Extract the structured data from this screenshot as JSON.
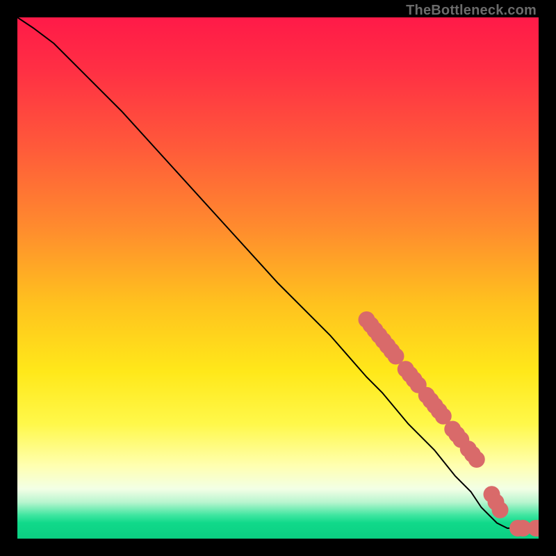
{
  "watermark": "TheBottleneck.com",
  "colors": {
    "background": "#000000",
    "marker": "#d96a6a",
    "line": "#000000",
    "gradient_stops": [
      {
        "offset": 0.0,
        "color": "#ff1a48"
      },
      {
        "offset": 0.1,
        "color": "#ff2f44"
      },
      {
        "offset": 0.25,
        "color": "#ff5a3a"
      },
      {
        "offset": 0.4,
        "color": "#ff8a2e"
      },
      {
        "offset": 0.55,
        "color": "#ffc21e"
      },
      {
        "offset": 0.68,
        "color": "#ffe81a"
      },
      {
        "offset": 0.78,
        "color": "#fff84a"
      },
      {
        "offset": 0.86,
        "color": "#ffffb0"
      },
      {
        "offset": 0.905,
        "color": "#f2ffe6"
      },
      {
        "offset": 0.93,
        "color": "#b9f5cf"
      },
      {
        "offset": 0.955,
        "color": "#3fe6a0"
      },
      {
        "offset": 0.97,
        "color": "#10d98a"
      },
      {
        "offset": 1.0,
        "color": "#0bcf82"
      }
    ]
  },
  "chart_data": {
    "type": "line",
    "title": "",
    "xlabel": "",
    "ylabel": "",
    "xlim": [
      0,
      100
    ],
    "ylim": [
      0,
      100
    ],
    "grid": false,
    "legend": false,
    "series": [
      {
        "name": "curve",
        "kind": "line",
        "x": [
          0,
          3,
          7,
          10,
          14,
          20,
          30,
          40,
          50,
          60,
          67,
          70,
          75,
          80,
          84,
          87,
          89,
          90,
          92,
          94,
          96,
          98,
          100
        ],
        "y": [
          100,
          98,
          95,
          92,
          88,
          82,
          71,
          60,
          49,
          39,
          31,
          28,
          22,
          17,
          12,
          9,
          6,
          5,
          3,
          2,
          2,
          2,
          2
        ]
      },
      {
        "name": "markers",
        "kind": "scatter",
        "points": [
          {
            "x": 67.0,
            "y": 42.0,
            "r": 1.6
          },
          {
            "x": 67.8,
            "y": 41.0,
            "r": 1.6
          },
          {
            "x": 68.6,
            "y": 40.0,
            "r": 1.6
          },
          {
            "x": 69.4,
            "y": 39.0,
            "r": 1.6
          },
          {
            "x": 70.2,
            "y": 38.0,
            "r": 1.6
          },
          {
            "x": 71.0,
            "y": 37.0,
            "r": 1.6
          },
          {
            "x": 71.8,
            "y": 36.0,
            "r": 1.6
          },
          {
            "x": 72.6,
            "y": 35.0,
            "r": 1.6
          },
          {
            "x": 74.5,
            "y": 32.5,
            "r": 1.6
          },
          {
            "x": 75.3,
            "y": 31.5,
            "r": 1.6
          },
          {
            "x": 76.1,
            "y": 30.5,
            "r": 1.6
          },
          {
            "x": 76.9,
            "y": 29.5,
            "r": 1.6
          },
          {
            "x": 78.5,
            "y": 27.5,
            "r": 1.6
          },
          {
            "x": 79.3,
            "y": 26.5,
            "r": 1.6
          },
          {
            "x": 80.1,
            "y": 25.5,
            "r": 1.6
          },
          {
            "x": 80.9,
            "y": 24.5,
            "r": 1.6
          },
          {
            "x": 81.7,
            "y": 23.5,
            "r": 1.6
          },
          {
            "x": 83.5,
            "y": 21.0,
            "r": 1.6
          },
          {
            "x": 84.3,
            "y": 20.0,
            "r": 1.6
          },
          {
            "x": 85.1,
            "y": 19.0,
            "r": 1.6
          },
          {
            "x": 86.5,
            "y": 17.2,
            "r": 1.6
          },
          {
            "x": 87.3,
            "y": 16.2,
            "r": 1.6
          },
          {
            "x": 88.1,
            "y": 15.2,
            "r": 1.6
          },
          {
            "x": 91.0,
            "y": 8.5,
            "r": 1.6
          },
          {
            "x": 91.8,
            "y": 7.0,
            "r": 1.6
          },
          {
            "x": 92.6,
            "y": 5.5,
            "r": 1.6
          },
          {
            "x": 96.0,
            "y": 2.0,
            "r": 1.6
          },
          {
            "x": 97.0,
            "y": 2.0,
            "r": 1.6
          },
          {
            "x": 99.5,
            "y": 2.0,
            "r": 1.6
          },
          {
            "x": 100.0,
            "y": 2.0,
            "r": 1.6
          }
        ]
      }
    ]
  }
}
